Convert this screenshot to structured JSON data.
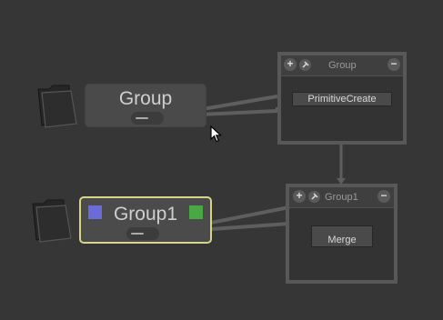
{
  "colors": {
    "background": "#363636",
    "selected_border": "#d6d588",
    "input_swatch": "#6b6cd9",
    "output_swatch": "#49a844",
    "wire": "#5e5e5e"
  },
  "nodes": [
    {
      "title": "Group",
      "selected": false
    },
    {
      "title": "Group1",
      "selected": true
    }
  ],
  "panels": [
    {
      "title": "Group",
      "plus_label": "+",
      "minus_label": "−",
      "inner_node": "PrimitiveCreate"
    },
    {
      "title": "Group1",
      "plus_label": "+",
      "minus_label": "−",
      "inner_node": "Merge"
    }
  ],
  "icons": {
    "folder": "folder-icon",
    "pin": "pin-icon",
    "cursor": "mouse-cursor-icon"
  }
}
